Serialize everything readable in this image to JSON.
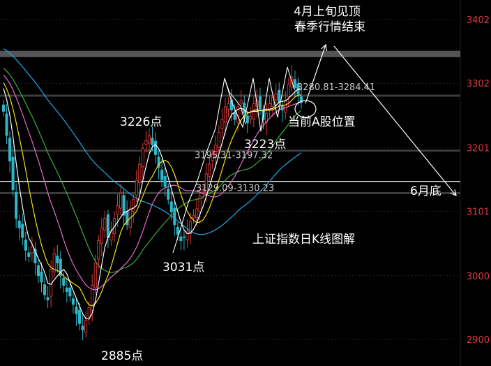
{
  "chart_data": {
    "type": "candlestick",
    "title": "上证指数日K线图解",
    "y_ticks": [
      3402,
      3302,
      3201,
      3101,
      3000,
      2900
    ],
    "ylim": [
      2880,
      3440
    ],
    "zones": [
      {
        "label": "3280.81-3284.41",
        "value": 3282.6
      },
      {
        "label": "3195.31-3197.32",
        "value": 3196.3
      },
      {
        "label": "3129.09-3130.23",
        "value": 3129.7
      }
    ],
    "resistance_band": {
      "from": 3343,
      "to": 3353
    },
    "support_line": 3148,
    "annotations": {
      "low_2885": "2885点",
      "high_3226": "3226点",
      "low_3031": "3031点",
      "low_3223": "3223点",
      "current": "当前A股位置",
      "top_line1": "4月上旬见顶",
      "top_line2": "春季行情结束",
      "bottom": "6月底"
    },
    "colors": {
      "up": "#e03a3a",
      "down": "#2fb5c6",
      "ma5": "#ffffff",
      "ma10": "#f3e21b",
      "ma20": "#e86bd0",
      "ma30": "#3cae3c",
      "ma60": "#1fa8e8"
    },
    "candle_closes": [
      3258,
      3220,
      3180,
      3135,
      3090,
      3075,
      3060,
      3040,
      3030,
      3045,
      3020,
      3000,
      2990,
      2970,
      2962,
      3010,
      3035,
      3020,
      3000,
      2985,
      2975,
      2968,
      2955,
      2940,
      2925,
      2915,
      2930,
      2950,
      2985,
      3020,
      3055,
      3075,
      3090,
      3060,
      3070,
      3090,
      3110,
      3130,
      3095,
      3080,
      3105,
      3120,
      3150,
      3175,
      3200,
      3212,
      3220,
      3205,
      3190,
      3170,
      3150,
      3140,
      3120,
      3100,
      3080,
      3065,
      3055,
      3060,
      3070,
      3085,
      3095,
      3105,
      3125,
      3135,
      3160,
      3175,
      3190,
      3205,
      3225,
      3245,
      3265,
      3270,
      3260,
      3245,
      3265,
      3275,
      3255,
      3240,
      3250,
      3270,
      3275,
      3262,
      3245,
      3255,
      3270,
      3280,
      3285,
      3272,
      3260,
      3275,
      3300,
      3312,
      3295,
      3285,
      3272
    ]
  }
}
